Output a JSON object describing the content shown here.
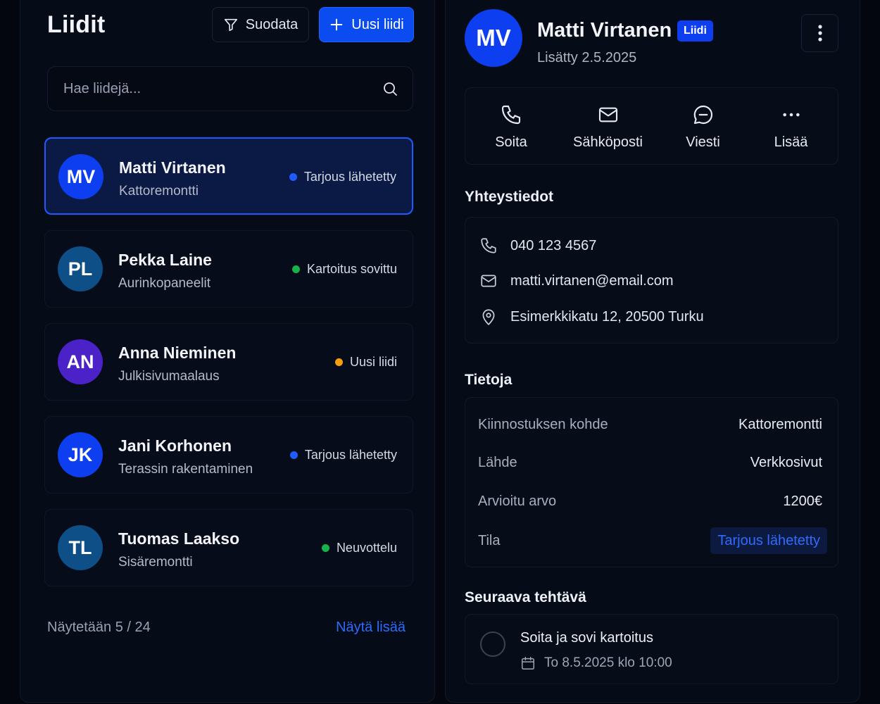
{
  "leads_panel": {
    "title": "Liidit",
    "filter_label": "Suodata",
    "new_lead_label": "Uusi liidi",
    "search_placeholder": "Hae liidejä...",
    "leads": [
      {
        "initials": "MV",
        "name": "Matti Virtanen",
        "project": "Kattoremontti",
        "status": "Tarjous lähetetty",
        "status_color": "#1f5bff",
        "avatar_color": "#0d3ff0",
        "selected": true
      },
      {
        "initials": "PL",
        "name": "Pekka Laine",
        "project": "Aurinkopaneelit",
        "status": "Kartoitus sovittu",
        "status_color": "#16b34a",
        "avatar_color": "#0d4f86",
        "selected": false
      },
      {
        "initials": "AN",
        "name": "Anna Nieminen",
        "project": "Julkisivumaalaus",
        "status": "Uusi liidi",
        "status_color": "#f59e0b",
        "avatar_color": "#4a22c8",
        "selected": false
      },
      {
        "initials": "JK",
        "name": "Jani Korhonen",
        "project": "Terassin rakentaminen",
        "status": "Tarjous lähetetty",
        "status_color": "#1f5bff",
        "avatar_color": "#0d3ff0",
        "selected": false
      },
      {
        "initials": "TL",
        "name": "Tuomas Laakso",
        "project": "Sisäremontti",
        "status": "Neuvottelu",
        "status_color": "#16b34a",
        "avatar_color": "#0d4f86",
        "selected": false
      }
    ],
    "footer_count": "Näytetään 5 / 24",
    "footer_more": "Näytä lisää"
  },
  "detail": {
    "initials": "MV",
    "name": "Matti Virtanen",
    "badge": "Liidi",
    "added": "Lisätty 2.5.2025",
    "actions": [
      {
        "label": "Soita",
        "icon": "phone-icon"
      },
      {
        "label": "Sähköposti",
        "icon": "mail-icon"
      },
      {
        "label": "Viesti",
        "icon": "message-icon"
      },
      {
        "label": "Lisää",
        "icon": "more-icon"
      }
    ],
    "contact_title": "Yhteystiedot",
    "contact": {
      "phone": "040 123 4567",
      "email": "matti.virtanen@email.com",
      "address": "Esimerkkikatu 12, 20500 Turku"
    },
    "info_title": "Tietoja",
    "info": [
      {
        "label": "Kiinnostuksen kohde",
        "value": "Kattoremontti"
      },
      {
        "label": "Lähde",
        "value": "Verkkosivut"
      },
      {
        "label": "Arvioitu arvo",
        "value": "1200€"
      },
      {
        "label": "Tila",
        "value": "Tarjous lähetetty"
      }
    ],
    "task_title": "Seuraava tehtävä",
    "task": {
      "title": "Soita ja sovi kartoitus",
      "date": "To 8.5.2025 klo 10:00"
    }
  },
  "colors": {
    "accent": "#0a4cf0",
    "background": "#03060f",
    "link": "#2d6bff"
  }
}
